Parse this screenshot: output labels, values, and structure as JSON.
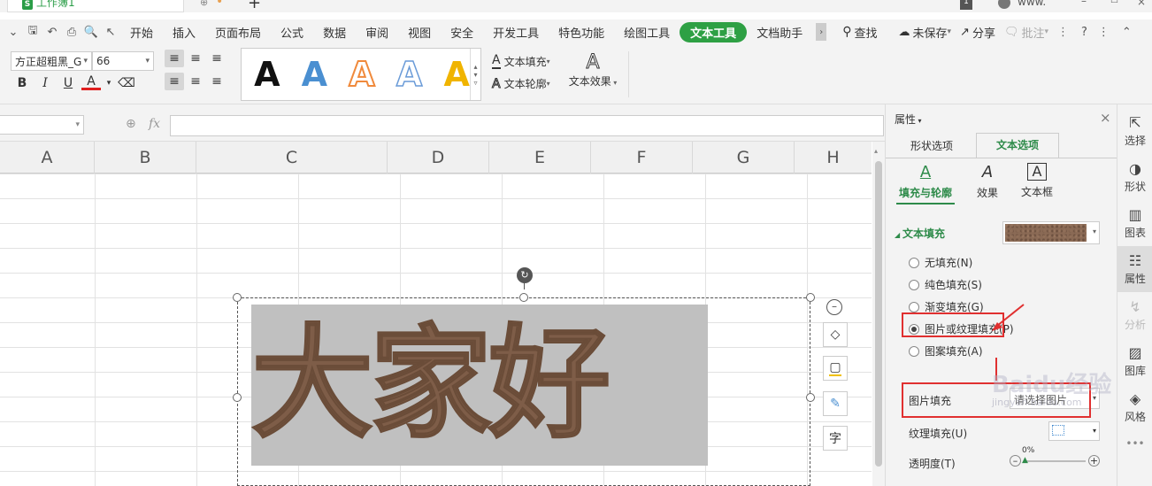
{
  "titlebar": {
    "doc_tab": "工作簿1",
    "new_tab": "+",
    "user": "www."
  },
  "menu": {
    "items": [
      "开始",
      "插入",
      "页面布局",
      "公式",
      "数据",
      "审阅",
      "视图",
      "安全",
      "开发工具",
      "特色功能",
      "绘图工具",
      "文本工具",
      "文档助手"
    ],
    "active": "文本工具",
    "search": "查找",
    "unsaved": "未保存",
    "share": "分享",
    "comment": "批注"
  },
  "ribbon": {
    "font_name": "方正超粗黑_G",
    "font_size": "66",
    "text_fill": "文本填充",
    "text_outline": "文本轮廓",
    "text_effect": "文本效果",
    "wordart_colors": [
      "#111111",
      "#4a8fd1",
      "#f08a3c",
      "#6a9bd8",
      "#f0b400"
    ]
  },
  "formula": {
    "fx": "fx"
  },
  "columns": [
    "A",
    "B",
    "C",
    "D",
    "E",
    "F",
    "G",
    "H"
  ],
  "textbox": {
    "content": "大家好"
  },
  "panel": {
    "title": "属性",
    "tabs": [
      "形状选项",
      "文本选项"
    ],
    "active_tab": "文本选项",
    "subtabs": [
      "填充与轮廓",
      "效果",
      "文本框"
    ],
    "section": "文本填充",
    "radios": [
      "无填充(N)",
      "纯色填充(S)",
      "渐变填充(G)",
      "图片或纹理填充(P)",
      "图案填充(A)"
    ],
    "selected_radio": "图片或纹理填充(P)",
    "picture_fill_label": "图片填充",
    "picture_fill_value": "请选择图片",
    "texture_fill_label": "纹理填充(U)",
    "transparency_label": "透明度(T)",
    "transparency_value": "0%"
  },
  "rightbar": {
    "items": [
      "选择",
      "形状",
      "图表",
      "属性",
      "分析",
      "图库",
      "风格"
    ],
    "more": "•••"
  },
  "watermark": {
    "main": "Baidu经验",
    "sub": "jingyan.baidu.com"
  }
}
